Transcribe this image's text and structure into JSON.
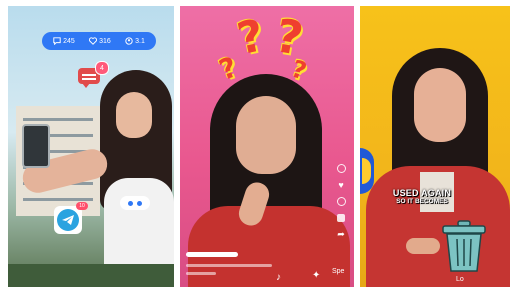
{
  "panel1": {
    "stats": [
      {
        "icon": "comment-icon",
        "value": "245"
      },
      {
        "icon": "heart-icon",
        "value": "316"
      },
      {
        "icon": "user-icon",
        "value": "3.1"
      }
    ],
    "notification_count": "4",
    "telegram_badge": "10"
  },
  "panel2": {
    "side_icons": [
      "add-icon",
      "heart-icon",
      "comment-icon",
      "bookmark-icon",
      "share-icon"
    ],
    "share_label": "Spe"
  },
  "panel3": {
    "caption_line1": "USED AGAIN",
    "caption_line2": "SO IT BECOMES",
    "bottom_label": "Lo"
  },
  "colors": {
    "accent_blue": "#2f78f5",
    "pink_bg": "#e9588f",
    "yellow_bg": "#f2b51b",
    "jacket_red": "#c53532",
    "question_mark": "#ef3f2f"
  }
}
